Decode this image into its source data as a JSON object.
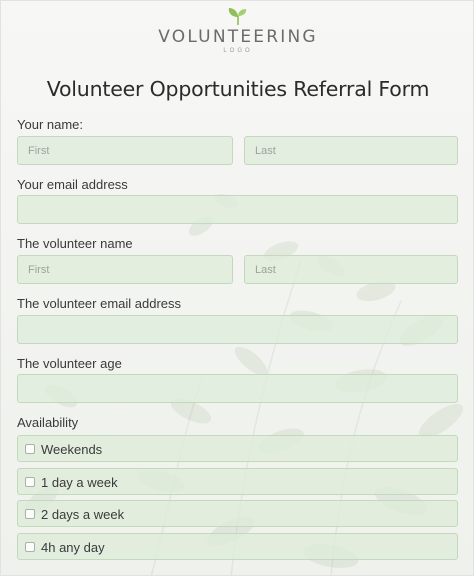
{
  "logo": {
    "name": "VOLUNTEERING",
    "sub": "LOGO"
  },
  "form": {
    "title": "Volunteer Opportunities Referral Form",
    "your_name": {
      "label": "Your name:",
      "first_placeholder": "First",
      "last_placeholder": "Last"
    },
    "your_email": {
      "label": "Your email address",
      "placeholder": ""
    },
    "volunteer_name": {
      "label": "The volunteer name",
      "first_placeholder": "First",
      "last_placeholder": "Last"
    },
    "volunteer_email": {
      "label": "The volunteer email address",
      "placeholder": ""
    },
    "volunteer_age": {
      "label": "The volunteer age",
      "placeholder": ""
    },
    "availability": {
      "label": "Availability",
      "options": [
        {
          "label": "Weekends",
          "checked": false
        },
        {
          "label": "1 day a week",
          "checked": false
        },
        {
          "label": "2 days a week",
          "checked": false
        },
        {
          "label": "4h any day",
          "checked": false
        }
      ]
    }
  },
  "colors": {
    "field_bg": "#deecda",
    "field_border": "#c4d8bd",
    "sprout": "#8fbf5a"
  }
}
